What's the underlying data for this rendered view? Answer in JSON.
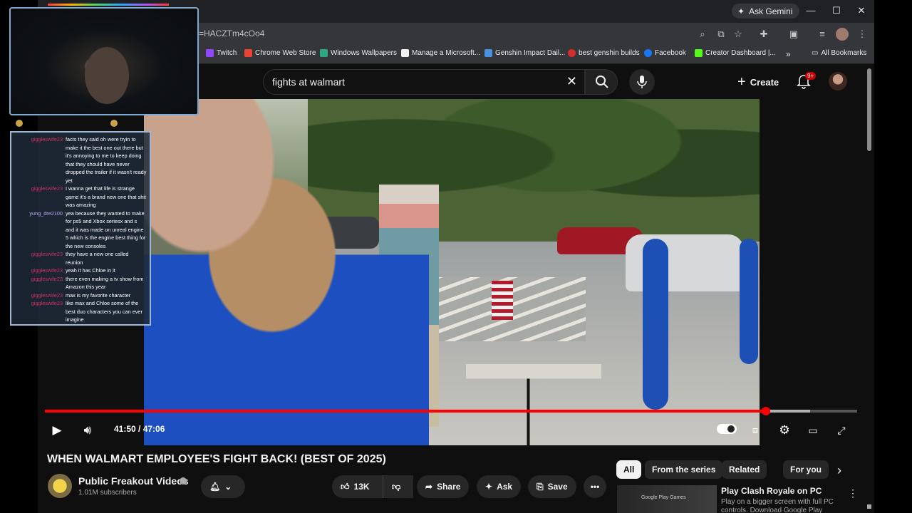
{
  "browser": {
    "gemini_label": "Ask Gemini",
    "url": "=HACZTm4cOo4",
    "bookmarks": [
      "Twitch",
      "Chrome Web Store",
      "Windows Wallpapers",
      "Manage a Microsoft...",
      "Genshin Impact Dail...",
      "best genshin builds",
      "Facebook",
      "Creator Dashboard |..."
    ],
    "bookmarks_more": "»",
    "all_bookmarks": "All Bookmarks",
    "colors": {
      "tabstrip": "#202124",
      "toolbar": "#35363a"
    }
  },
  "youtube": {
    "search_value": "fights at walmart",
    "create_label": "Create",
    "notif_badge": "9+"
  },
  "player": {
    "time": "41:50 / 47:06",
    "progress_fraction": 0.888,
    "buffer_fraction": 0.942,
    "accent": "#ff0000"
  },
  "video": {
    "title": "WHEN WALMART EMPLOYEE'S FIGHT BACK! (BEST OF 2025)",
    "channel": "Public Freakout Videos",
    "subscribers": "1.01M subscribers",
    "likes": "13K",
    "share": "Share",
    "ask": "Ask",
    "save": "Save"
  },
  "sidebar": {
    "filters": [
      "All",
      "From the series",
      "Related",
      "For you"
    ],
    "rec": {
      "title": "Play Clash Royale on PC",
      "desc": "Play on a bigger screen with full PC controls. Download Google Play",
      "thumb_label": "Google Play Games"
    }
  },
  "stream_overlay": {
    "chat": [
      {
        "user": "giggleswife23",
        "msg": "facts they said oh were tryin to make it the best one out there but it's annoying to me to keep doing that they should have never dropped the trailer if it wasn't ready yet",
        "color": "red"
      },
      {
        "user": "giggleswife23",
        "msg": "I wanna get that life is strange game it's a brand new one that shit was amazing",
        "color": "red"
      },
      {
        "user": "yung_dre2100",
        "msg": "yea because they wanted to make for ps5 and Xbox seriesx and s and it was made on unreal engine 5 which is the engine best thing for the new consoles",
        "color": "blue"
      },
      {
        "user": "giggleswife23",
        "msg": "they have a new one called reunion",
        "color": "red"
      },
      {
        "user": "giggleswife23",
        "msg": "yeah it has Chloe in it",
        "color": "red"
      },
      {
        "user": "giggleswife23",
        "msg": "there even making a tv show from Amazon this year",
        "color": "red"
      },
      {
        "user": "giggleswife23",
        "msg": "max is my favorite character",
        "color": "red"
      },
      {
        "user": "giggleswife23",
        "msg": "like max and Chloe some of the best duo characters you can ever imagine",
        "color": "red"
      }
    ]
  }
}
